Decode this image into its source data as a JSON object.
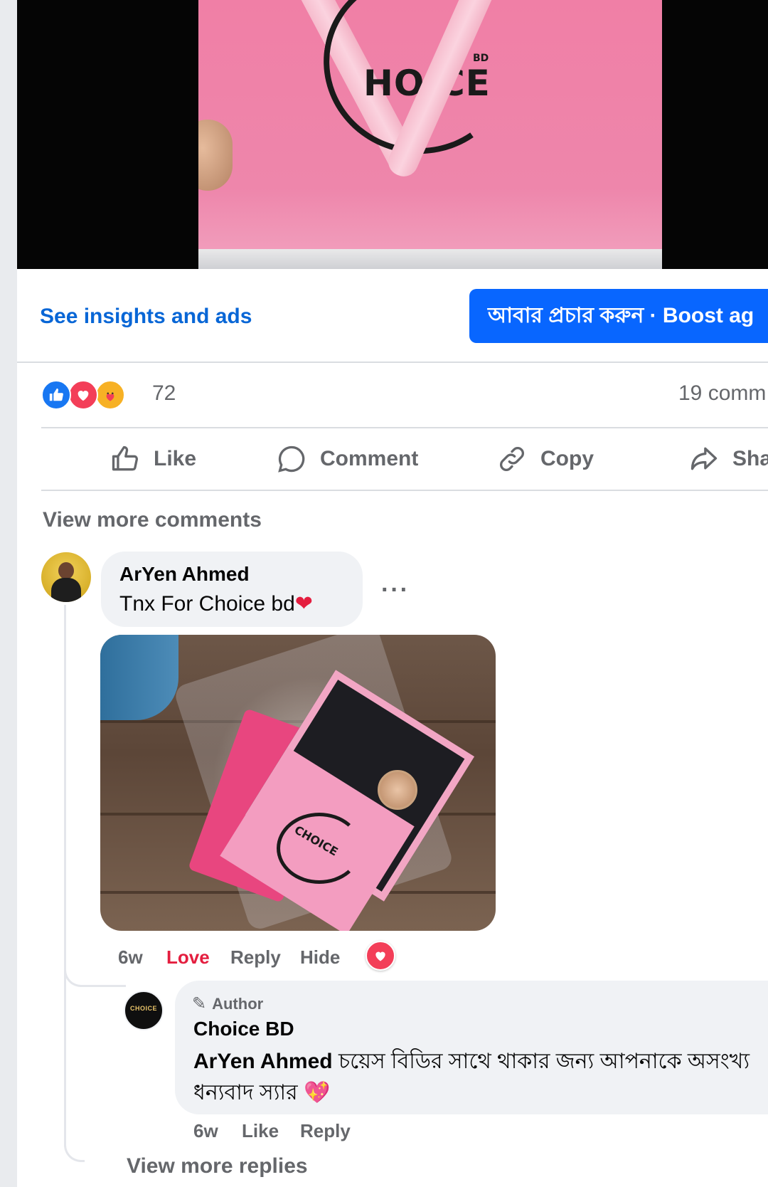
{
  "post": {
    "media": {
      "bag_brand_text": "HOICE",
      "bag_brand_sub": "BD"
    },
    "insights_link": "See insights and ads",
    "boost_button": "আবার প্রচার করুন · Boost ag",
    "reactions": {
      "icons": [
        "like-icon",
        "love-icon",
        "care-icon"
      ],
      "count": "72",
      "comments_count": "19 comm"
    },
    "actions": {
      "like": "Like",
      "comment": "Comment",
      "copy": "Copy",
      "share": "Share"
    }
  },
  "comments": {
    "view_more": "View more comments",
    "items": [
      {
        "author": "ArYen Ahmed",
        "text": "Tnx For Choice bd",
        "emoji": "❤",
        "photo_logo_text": "CHOICE",
        "time": "6w",
        "reaction_label": "Love",
        "reply_label": "Reply",
        "hide_label": "Hide",
        "more_label": "···"
      }
    ],
    "reply": {
      "author_badge": "Author",
      "author": "Choice BD",
      "avatar_text": "CHOICE",
      "mention": "ArYen Ahmed",
      "text": "চয়েস বিডির সাথে থাকার জন্য আপনাকে অসংখ্য ধন্যবাদ স্যার",
      "emoji": "💖",
      "time": "6w",
      "like_label": "Like",
      "reply_label": "Reply"
    },
    "view_more_replies": "View more replies"
  },
  "colors": {
    "accent": "#0866ff",
    "link": "#0866d6",
    "love": "#e41e3f",
    "muted": "#65676b",
    "bubble": "#f0f2f5"
  }
}
